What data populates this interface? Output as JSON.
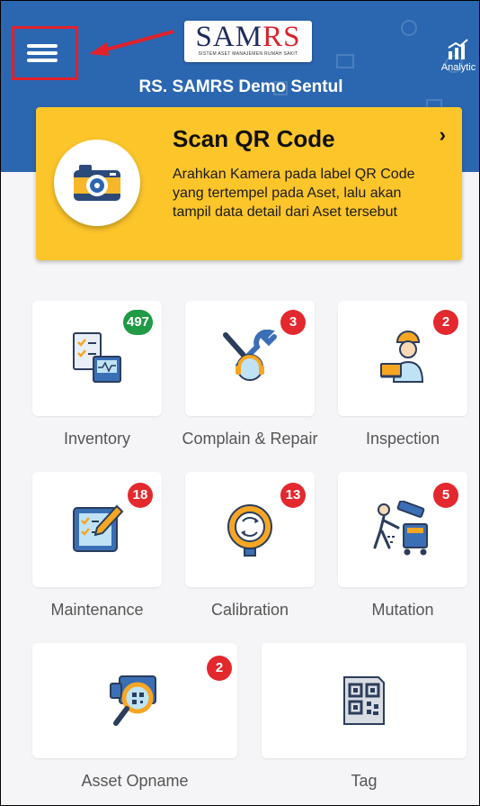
{
  "header": {
    "logo_main": "SAMRS",
    "logo_sub": "SISTEM ASET MANAJEMEN RUMAH SAKIT",
    "hospital_name": "RS. SAMRS Demo Sentul",
    "analytics_label": "Analytic",
    "menu_icon": "hamburger-icon"
  },
  "scan": {
    "title": "Scan QR Code",
    "description": "Arahkan Kamera pada label QR Code yang tertempel pada Aset, lalu akan tampil data detail dari Aset tersebut",
    "icon": "camera-icon"
  },
  "modules": [
    {
      "label": "Inventory",
      "badge": "497",
      "badge_color": "#1f9a45",
      "icon": "inventory-checklist-icon"
    },
    {
      "label": "Complain & Repair",
      "badge": "3",
      "badge_color": "#e3282e",
      "icon": "support-tools-icon"
    },
    {
      "label": "Inspection",
      "badge": "2",
      "badge_color": "#e3282e",
      "icon": "inspector-icon"
    },
    {
      "label": "Maintenance",
      "badge": "18",
      "badge_color": "#e3282e",
      "icon": "maintenance-clipboard-icon"
    },
    {
      "label": "Calibration",
      "badge": "13",
      "badge_color": "#e3282e",
      "icon": "calibration-gauge-icon"
    },
    {
      "label": "Mutation",
      "badge": "5",
      "badge_color": "#e3282e",
      "icon": "moving-cart-icon"
    },
    {
      "label": "Asset Opname",
      "badge": "2",
      "badge_color": "#e3282e",
      "icon": "asset-scan-magnifier-icon"
    },
    {
      "label": "Tag",
      "badge": "",
      "badge_color": "",
      "icon": "qr-tag-icon"
    }
  ],
  "colors": {
    "header": "#2b67b0",
    "scan_card": "#fcc52a",
    "badge_red": "#e3282e",
    "badge_green": "#1f9a45",
    "highlight": "#e3202a"
  }
}
